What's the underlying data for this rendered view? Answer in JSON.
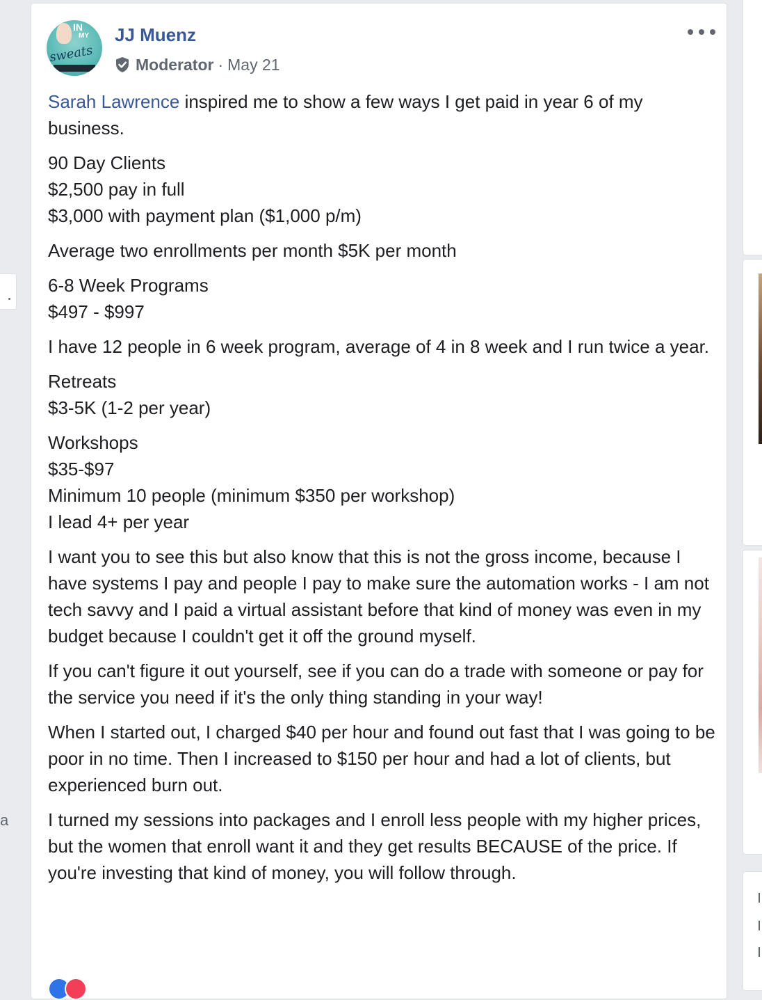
{
  "post": {
    "author": {
      "name": "JJ Muenz",
      "avatar_text_in": "IN",
      "avatar_text_my": "MY",
      "avatar_text_sweats": "sweats"
    },
    "role": "Moderator",
    "separator": "·",
    "date": "May 21",
    "mention": "Sarah Lawrence",
    "intro_rest": " inspired me to show a few ways I get paid in year 6 of my business.",
    "p2": [
      "90 Day Clients",
      "$2,500 pay in full",
      "$3,000 with payment plan ($1,000 p/m)"
    ],
    "p3": "Average two enrollments per month $5K per month",
    "p4": [
      "6-8 Week Programs",
      "$497 - $997"
    ],
    "p5": "I have 12 people in 6 week program, average of 4 in 8 week and I run twice a year.",
    "p6": [
      "Retreats",
      "$3-5K (1-2 per year)"
    ],
    "p7": [
      "Workshops",
      "$35-$97",
      "Minimum 10 people (minimum $350 per workshop)",
      "I lead 4+ per year"
    ],
    "p8": "I want you to see this but also know that this is not the gross income, because I have systems I pay and people I pay to make sure the automation works - I am not tech savvy and I paid a virtual assistant before that kind of money was even in my budget because I couldn't get it off the ground myself.",
    "p9": "If you can't figure it out yourself, see if you can do a trade with someone or pay for the service you need if it's the only thing standing in your way!",
    "p10": "When I started out, I charged $40 per hour and found out fast that I was going to be poor in no time. Then I increased to $150 per hour and had a lot of clients, but experienced burn out.",
    "p11": "I turned my sessions into packages and I enroll less people with my higher prices, but the women that enroll want it and they get results BECAUSE of the price. If you're investing that kind of money, you will follow through."
  },
  "left_gutter_letter": "a",
  "icons": {
    "more": "more-options-icon",
    "badge": "moderator-shield-check-icon",
    "reactions": [
      "like-reaction-icon",
      "love-reaction-icon"
    ]
  },
  "colors": {
    "link": "#385898",
    "meta": "#606770",
    "text": "#1c1e21",
    "background": "#e9ebee"
  }
}
